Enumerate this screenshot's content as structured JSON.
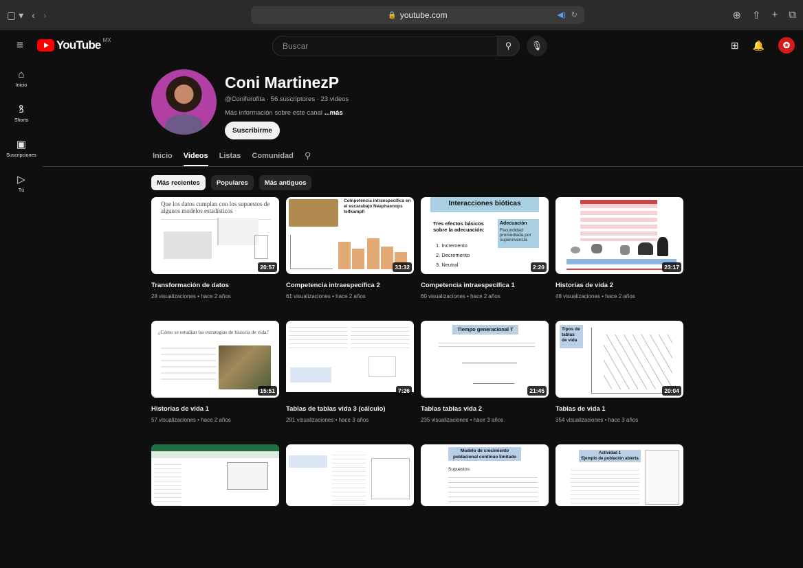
{
  "browser": {
    "url": "youtube.com"
  },
  "header": {
    "logo_text": "YouTube",
    "country": "MX",
    "search_placeholder": "Buscar"
  },
  "sidebar": {
    "items": [
      {
        "label": "Inicio",
        "icon": "home-icon"
      },
      {
        "label": "Shorts",
        "icon": "shorts-icon"
      },
      {
        "label": "Suscripciones",
        "icon": "subscriptions-icon"
      },
      {
        "label": "Tú",
        "icon": "you-icon"
      }
    ]
  },
  "channel": {
    "name": "Coni MartinezP",
    "meta": "@Coniferofita · 56 suscriptores · 23 videos",
    "more_text": "Más información sobre este canal ",
    "more_link": "...más",
    "subscribe_label": "Suscribirme"
  },
  "tabs": [
    "Inicio",
    "Videos",
    "Listas",
    "Comunidad"
  ],
  "chips": [
    "Más recientes",
    "Populares",
    "Más antiguos"
  ],
  "videos": [
    {
      "title": "Transformación de datos",
      "meta": "28 visualizaciones • hace 2 años",
      "duration": "20:57"
    },
    {
      "title": "Competencia intraespecífica 2",
      "meta": "61 visualizaciones • hace 2 años",
      "duration": "33:32"
    },
    {
      "title": "Competencia intraespecífica 1",
      "meta": "60 visualizaciones • hace 2 años",
      "duration": "2:20"
    },
    {
      "title": "Historias de vida 2",
      "meta": "48 visualizaciones • hace 2 años",
      "duration": "23:17"
    },
    {
      "title": "Historias de vida 1",
      "meta": "57 visualizaciones • hace 2 años",
      "duration": "15:51"
    },
    {
      "title": "Tablas de tablas vida 3 (cálculo)",
      "meta": "291 visualizaciones • hace 3 años",
      "duration": "7:26"
    },
    {
      "title": "Tablas tablas vida 2",
      "meta": "235 visualizaciones • hace 3 años",
      "duration": "21:45"
    },
    {
      "title": "Tablas de vida 1",
      "meta": "354 visualizaciones • hace 3 años",
      "duration": "20:04"
    }
  ],
  "thumb_text": {
    "t1_title": "Que los datos cumplan con los supuestos de algunos modelos estadísticos",
    "t2_title": "Competencia intraespecífica en el escarabajo Neaphaenops tellkampfi",
    "t3_title": "Interacciones bióticas",
    "t3_sub": "Tres efectos básicos sobre la adecuación:",
    "t3_list": [
      "1. Incremento",
      "2. Decremento",
      "3. Neutral"
    ],
    "t3_box_title": "Adecuación",
    "t3_box_text": "Fecundidad promediada por supervivencia",
    "t5_title": "¿Cómo se estudian las estrategias de historia de vida?",
    "t7_title": "Tiempo generacional T",
    "t8_title": "Tipos de tablas de vida",
    "t11_title": "Modelo de crecimiento poblacional contínuo limitado",
    "t11_sub": "Supuestos:",
    "t12_title": "Actividad 1",
    "t12_sub": "Ejemplo de población abierta"
  }
}
